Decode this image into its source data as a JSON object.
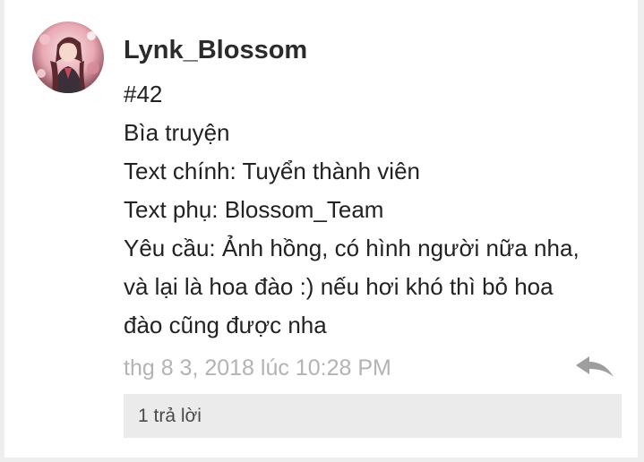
{
  "comment": {
    "author": "Lynk_Blossom",
    "lines": [
      "#42",
      "Bìa truyện",
      "Text chính: Tuyển thành viên",
      "Text phụ: Blossom_Team",
      "Yêu cầu: Ảnh hồng, có hình người nữa nha,",
      "và lại là hoa đào :) nếu hơi khó thì bỏ hoa",
      "đào cũng được nha"
    ],
    "timestamp": "thg 8 3, 2018 lúc 10:28 PM",
    "replies_label": "1 trả lời",
    "reply_icon": "reply-arrow-icon",
    "avatar_icon": "user-avatar"
  },
  "colors": {
    "background": "#eeeeee",
    "card": "#ffffff",
    "text": "#222222",
    "muted": "#b3b3b3",
    "replies_bar": "#ebebeb"
  }
}
